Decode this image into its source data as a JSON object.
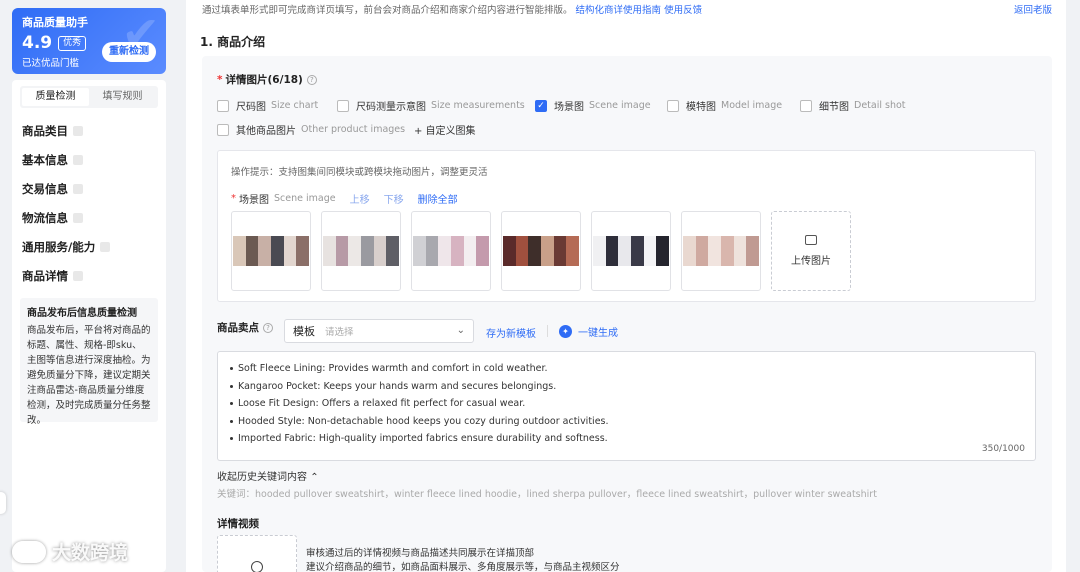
{
  "assistant": {
    "title": "商品质量助手",
    "score": "4.9",
    "grade": "优秀",
    "subtitle": "已达优品门槛",
    "recheck_label": "重新检测"
  },
  "side_tabs": [
    {
      "label": "质量检测",
      "active": true
    },
    {
      "label": "填写规则",
      "active": false
    }
  ],
  "nav_items": [
    "商品类目",
    "基本信息",
    "交易信息",
    "物流信息",
    "通用服务/能力",
    "商品详情"
  ],
  "info_box": {
    "title": "商品发布后信息质量检测",
    "body": "商品发布后，平台将对商品的标题、属性、规格-即sku、主图等信息进行深度抽检。为避免质量分下降，建议定期关注商品雷达-商品质量分维度检测，及时完成质量分任务整改。"
  },
  "topbar": {
    "text": "通过填表单形式即可完成商详页填写，前台会对商品介绍和商家介绍内容进行智能排版。",
    "guide_link": "结构化商详使用指南",
    "feedback_link": "使用反馈",
    "back_link": "返回老版"
  },
  "section_title": "1. 商品介绍",
  "detail_images": {
    "label": "详情图片(6/18)",
    "options": [
      {
        "zh": "尺码图",
        "en": "Size chart",
        "checked": false
      },
      {
        "zh": "尺码测量示意图",
        "en": "Size measurements",
        "checked": false
      },
      {
        "zh": "场景图",
        "en": "Scene image",
        "checked": true
      },
      {
        "zh": "模特图",
        "en": "Model image",
        "checked": false
      },
      {
        "zh": "细节图",
        "en": "Detail shot",
        "checked": false
      },
      {
        "zh": "其他商品图片",
        "en": "Other product images",
        "checked": false
      }
    ],
    "custom_set": "+ 自定义图集"
  },
  "image_module": {
    "tip": "操作提示：支持图集间同模块或跨模块拖动图片，调整更灵活",
    "scene_label": "场景图",
    "scene_en": "Scene image",
    "move_up": "上移",
    "move_down": "下移",
    "delete_all": "删除全部",
    "upload_label": "上传图片",
    "thumb_palettes": [
      [
        "#d9c7b8",
        "#6b5a52",
        "#c8b0a6",
        "#4a4a52",
        "#e2d6cf",
        "#8b6f68"
      ],
      [
        "#e7e2e0",
        "#b79aa6",
        "#ece8e6",
        "#9a9aa0",
        "#d8cfcc",
        "#5f5f66"
      ],
      [
        "#d0d0d4",
        "#a8a8ae",
        "#efe6ea",
        "#d7b3c1",
        "#f3eef0",
        "#c49aac"
      ],
      [
        "#5a2a2a",
        "#a0503e",
        "#3e2e2a",
        "#c9a089",
        "#6a3a34",
        "#b56b55"
      ],
      [
        "#f0f0f2",
        "#2e2e3a",
        "#e8e8ec",
        "#3a3a48",
        "#f4f4f6",
        "#25252e"
      ],
      [
        "#e9d8d0",
        "#cfa9a0",
        "#f1e4df",
        "#d9b6ad",
        "#eee2dc",
        "#c09a92"
      ]
    ]
  },
  "selling_points": {
    "label": "商品卖点",
    "template_tag": "模板",
    "template_placeholder": "请选择",
    "save_template": "存为新模板",
    "generate": "一键生成",
    "bullets": [
      "Soft Fleece Lining: Provides warmth and comfort in cold weather.",
      "Kangaroo Pocket: Keeps your hands warm and secures belongings.",
      "Loose Fit Design: Offers a relaxed fit perfect for casual wear.",
      "Hooded Style: Non-detachable hood keeps you cozy during outdoor activities.",
      "Imported Fabric: High-quality imported fabrics ensure durability and softness."
    ],
    "counter": "350/1000"
  },
  "history": {
    "collapse_label": "收起历史关键词内容",
    "keywords": "关键词：hooded pullover sweatshirt，winter fleece lined hoodie，lined sherpa pullover，fleece lined sweatshirt，pullover winter sweatshirt"
  },
  "video": {
    "label": "详情视频",
    "desc_line1": "审核通过后的详情视频与商品描述共同展示在详描顶部",
    "desc_line2": "建议介绍商品的细节，如商品面料展示、多角度展示等，与商品主视频区分"
  },
  "watermark": "大数跨境",
  "colors": {
    "accent": "#2f6cf5",
    "required": "#e33333"
  }
}
